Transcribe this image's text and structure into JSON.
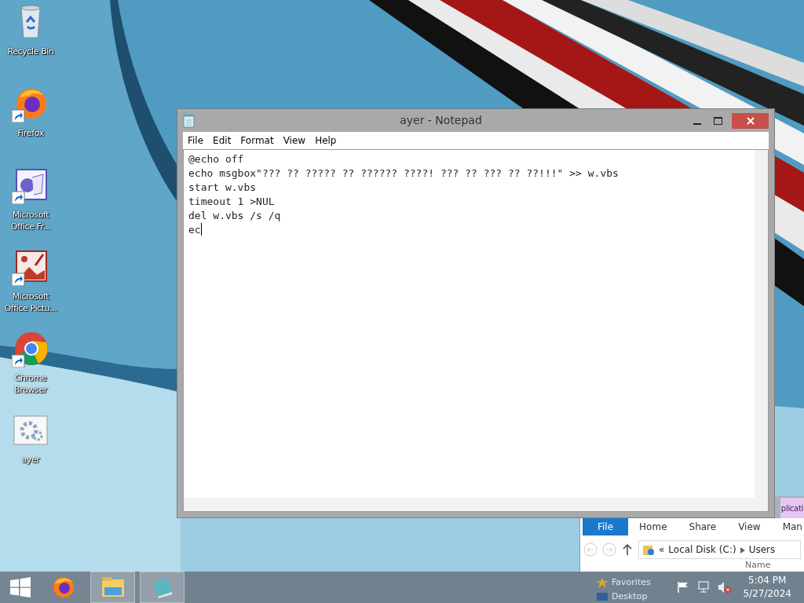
{
  "desktop_icons": [
    {
      "label": "Recycle Bin",
      "kind": "recycle",
      "shortcut": false
    },
    {
      "label": "Firefox",
      "kind": "firefox",
      "shortcut": true
    },
    {
      "label": "Microsoft Office Fr...",
      "kind": "publisher",
      "shortcut": true
    },
    {
      "label": "Microsoft Office Pictu...",
      "kind": "picture-manager",
      "shortcut": true
    },
    {
      "label": "Chrome Browser",
      "kind": "chrome",
      "shortcut": true
    },
    {
      "label": "ayer",
      "kind": "batch",
      "shortcut": false
    }
  ],
  "notepad": {
    "title": "ayer - Notepad",
    "menu": [
      "File",
      "Edit",
      "Format",
      "View",
      "Help"
    ],
    "lines": [
      "@echo off",
      "echo msgbox\"??? ?? ????? ?? ?????? ????! ??? ?? ??? ?? ??!!!\" >> w.vbs",
      "start w.vbs",
      "timeout 1 >NUL",
      "del w.vbs /s /q",
      "ec"
    ]
  },
  "explorer": {
    "contextual_tab": "plicati",
    "ribbon_tabs": [
      {
        "label": "File",
        "selected": true
      },
      {
        "label": "Home",
        "selected": false
      },
      {
        "label": "Share",
        "selected": false
      },
      {
        "label": "View",
        "selected": false
      },
      {
        "label": "Man",
        "selected": false
      }
    ],
    "address_prefix": "«",
    "address": [
      "Local Disk (C:)",
      "Users"
    ],
    "column_header": "Name",
    "nav_items": [
      {
        "label": "Favorites",
        "kind": "star"
      },
      {
        "label": "Desktop",
        "kind": "folder"
      }
    ]
  },
  "taskbar": {
    "apps": [
      {
        "kind": "firefox",
        "active": false
      },
      {
        "kind": "explorer",
        "active": true
      },
      {
        "kind": "notepad",
        "active": true
      }
    ],
    "time": "5:04 PM",
    "date": "5/27/2024"
  }
}
